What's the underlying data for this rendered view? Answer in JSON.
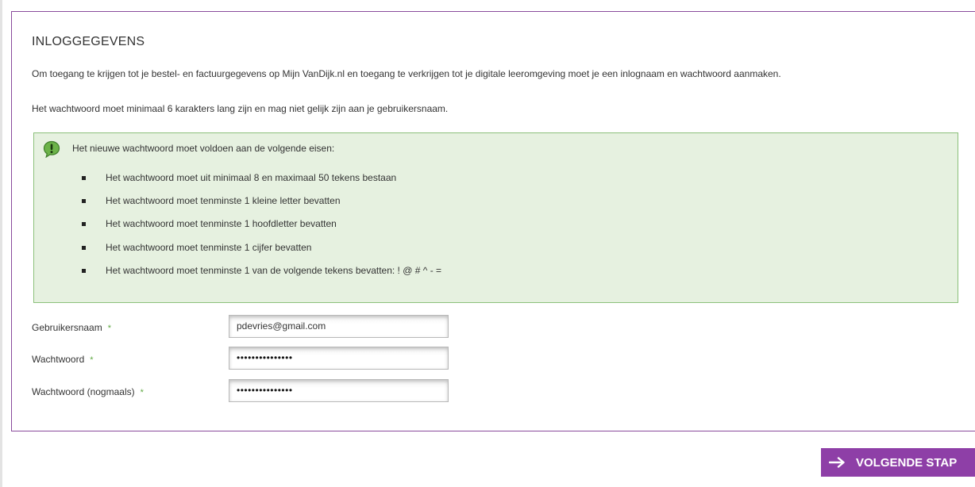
{
  "section": {
    "title": "INLOGGEGEVENS",
    "intro": "Om toegang te krijgen tot je bestel- en factuurgegevens op Mijn VanDijk.nl en toegang te verkrijgen tot je digitale leeromgeving moet je een inlognaam en wachtwoord aanmaken.",
    "password_note": "Het wachtwoord moet minimaal 6 karakters lang zijn en mag niet gelijk zijn aan je gebruikersnaam."
  },
  "requirements": {
    "icon": "exclamation-speech-bubble-icon",
    "heading": "Het nieuwe wachtwoord moet voldoen aan de volgende eisen:",
    "items": [
      "Het wachtwoord moet uit minimaal 8 en maximaal 50 tekens bestaan",
      "Het wachtwoord moet tenminste 1 kleine letter bevatten",
      "Het wachtwoord moet tenminste 1 hoofdletter bevatten",
      "Het wachtwoord moet tenminste 1 cijfer bevatten",
      "Het wachtwoord moet tenminste 1 van de volgende tekens bevatten: ! @ # ^ - ="
    ]
  },
  "form": {
    "required_marker": "*",
    "username": {
      "label": "Gebruikersnaam",
      "value": "pdevries@gmail.com"
    },
    "password": {
      "label": "Wachtwoord",
      "value": "•••••••••••••••"
    },
    "password_repeat": {
      "label": "Wachtwoord (nogmaals)",
      "value": "•••••••••••••••"
    }
  },
  "actions": {
    "next_label": "VOLGENDE STAP",
    "next_icon": "arrow-right-icon"
  },
  "colors": {
    "panel_border": "#8a4b9c",
    "requirements_bg": "#e6f1e0",
    "requirements_border": "#8cc07b",
    "required_star": "#5fa843",
    "button_bg": "#8e3fa7"
  }
}
